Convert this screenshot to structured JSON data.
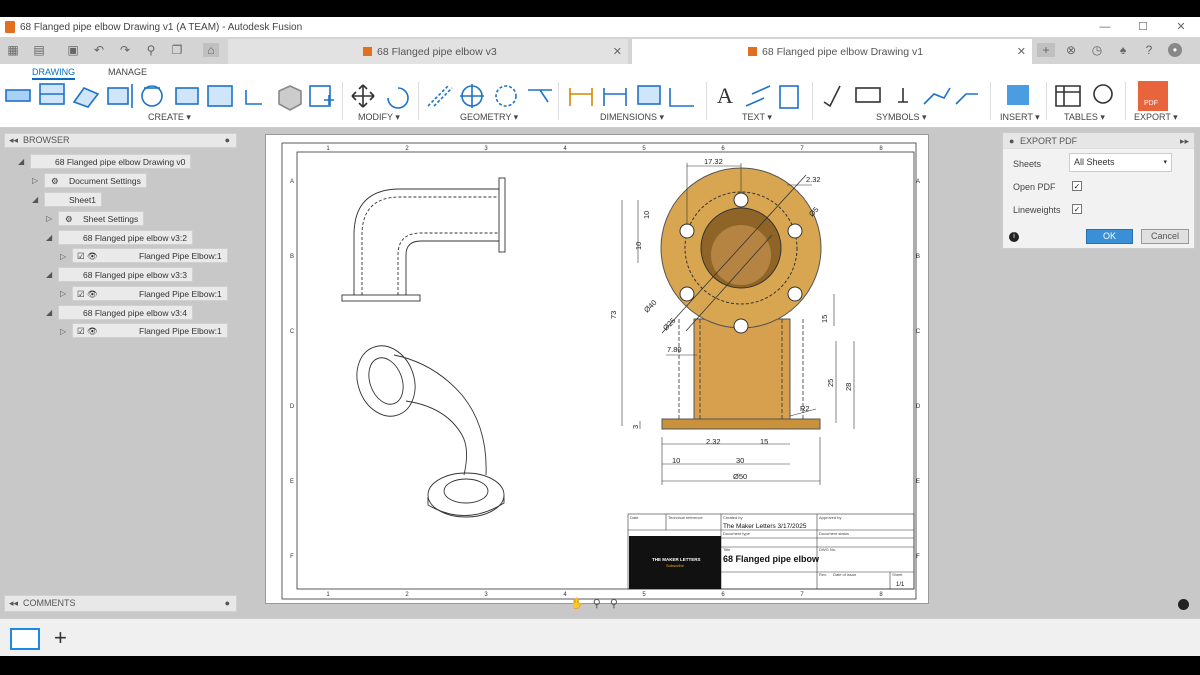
{
  "window": {
    "title": "68 Flanged pipe elbow Drawing v1 (A TEAM) - Autodesk Fusion"
  },
  "tabs": [
    {
      "label": "68 Flanged pipe elbow v3"
    },
    {
      "label": "68 Flanged pipe elbow Drawing v1"
    }
  ],
  "ribbon": {
    "tabs": [
      "DRAWING",
      "MANAGE"
    ],
    "groups": [
      "CREATE ▾",
      "MODIFY ▾",
      "GEOMETRY ▾",
      "DIMENSIONS ▾",
      "TEXT ▾",
      "SYMBOLS ▾",
      "INSERT ▾",
      "TABLES ▾",
      "EXPORT ▾"
    ],
    "pdf_label": "PDF"
  },
  "browser": {
    "title": "BROWSER",
    "items": [
      "68 Flanged pipe elbow Drawing v0",
      "Document Settings",
      "Sheet1",
      "Sheet Settings",
      "68 Flanged pipe elbow v3:2",
      "Flanged Pipe Elbow:1",
      "68 Flanged pipe elbow v3:3",
      "Flanged Pipe Elbow:1",
      "68 Flanged pipe elbow v3:4",
      "Flanged Pipe Elbow:1"
    ]
  },
  "comments": {
    "title": "COMMENTS"
  },
  "export_pdf": {
    "title": "EXPORT PDF",
    "sheets_label": "Sheets",
    "sheets_value": "All Sheets",
    "open_pdf_label": "Open PDF",
    "lineweights_label": "Lineweights",
    "ok": "OK",
    "cancel": "Cancel"
  },
  "drawing": {
    "cols": [
      "1",
      "2",
      "3",
      "4",
      "5",
      "6",
      "7",
      "8"
    ],
    "rows": [
      "A",
      "B",
      "C",
      "D",
      "E",
      "F"
    ],
    "dims": [
      "17.32",
      "2.32",
      "10",
      "10",
      "Ø5",
      "Ø40",
      "Ø25",
      "73",
      "15",
      "7.80",
      "25",
      "28",
      "R2",
      "3",
      "2.32",
      "15",
      "10",
      "30",
      "Ø50"
    ],
    "title_block": {
      "date_lbl": "Date",
      "tech_lbl": "Technical reference",
      "created_lbl": "Created by",
      "approved_lbl": "Approved by",
      "created": "The Maker Letters 3/17/2025",
      "doctype_lbl": "Document type",
      "status_lbl": "Document status",
      "title_lbl": "Title",
      "title": "68 Flanged pipe elbow",
      "dwgno_lbl": "DWG No.",
      "rev_lbl": "Rev.",
      "issue_lbl": "Date of issue",
      "sheet_lbl": "Sheet",
      "sheet": "1/1",
      "logo_line1": "THE MAKER LETTERS",
      "logo_line2": "Subscribe"
    }
  }
}
